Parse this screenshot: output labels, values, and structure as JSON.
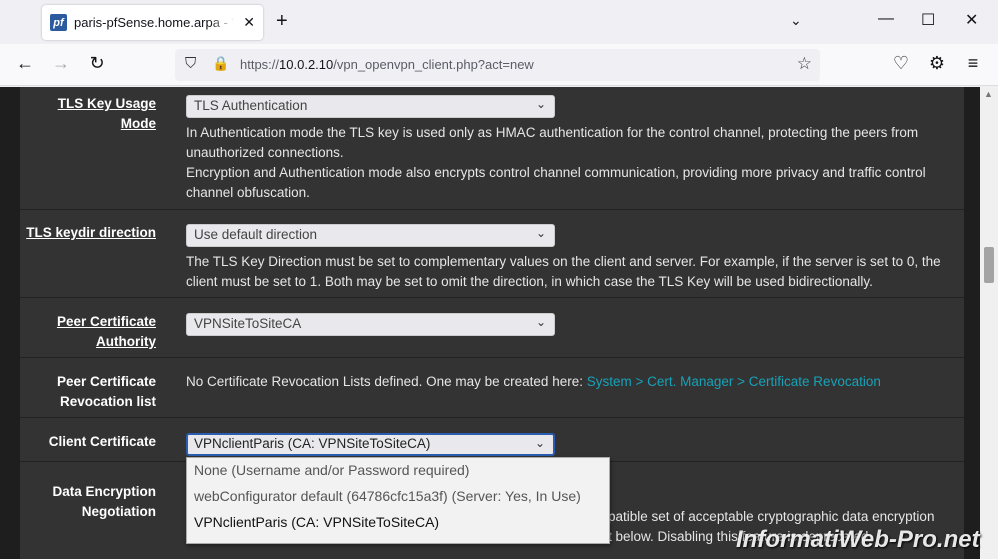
{
  "browser": {
    "tab_title": "paris-pfSense.home.arpa - VPN: OpenVPN: Clients: Edit",
    "favicon_text": "pf",
    "url_prefix": "https://",
    "url_host": "10.0.2.10",
    "url_path": "/vpn_openvpn_client.php?act=new"
  },
  "form": {
    "tls_key_usage": {
      "label": "TLS Key Usage Mode",
      "value": "TLS Authentication",
      "help1": "In Authentication mode the TLS key is used only as HMAC authentication for the control channel, protecting the peers from unauthorized connections.",
      "help2": "Encryption and Authentication mode also encrypts control channel communication, providing more privacy and traffic control channel obfuscation."
    },
    "tls_keydir": {
      "label": "TLS keydir direction",
      "value": "Use default direction",
      "help": "The TLS Key Direction must be set to complementary values on the client and server. For example, if the server is set to 0, the client must be set to 1. Both may be set to omit the direction, in which case the TLS Key will be used bidirectionally."
    },
    "peer_ca": {
      "label": "Peer Certificate Authority",
      "value": "VPNSiteToSiteCA"
    },
    "peer_crl": {
      "label": "Peer Certificate Revocation list",
      "text": "No Certificate Revocation Lists defined. One may be created here: ",
      "link": "System > Cert. Manager > Certificate Revocation"
    },
    "client_cert": {
      "label": "Client Certificate",
      "value": "VPNclientParis (CA: VPNSiteToSiteCA)",
      "options": [
        "None (Username and/or Password required)",
        "webConfigurator default (64786cfc15a3f) (Server: Yes, In Use)",
        "VPNclientParis (CA: VPNSiteToSiteCA)"
      ]
    },
    "data_encryption": {
      "label": "Data Encryption Negotiation",
      "help_partial1": "patible set of acceptable cryptographic data encryption",
      "help_partial2": "t below. Disabling this feature is deprecated."
    }
  },
  "watermark": "InformatiWeb-Pro.net"
}
